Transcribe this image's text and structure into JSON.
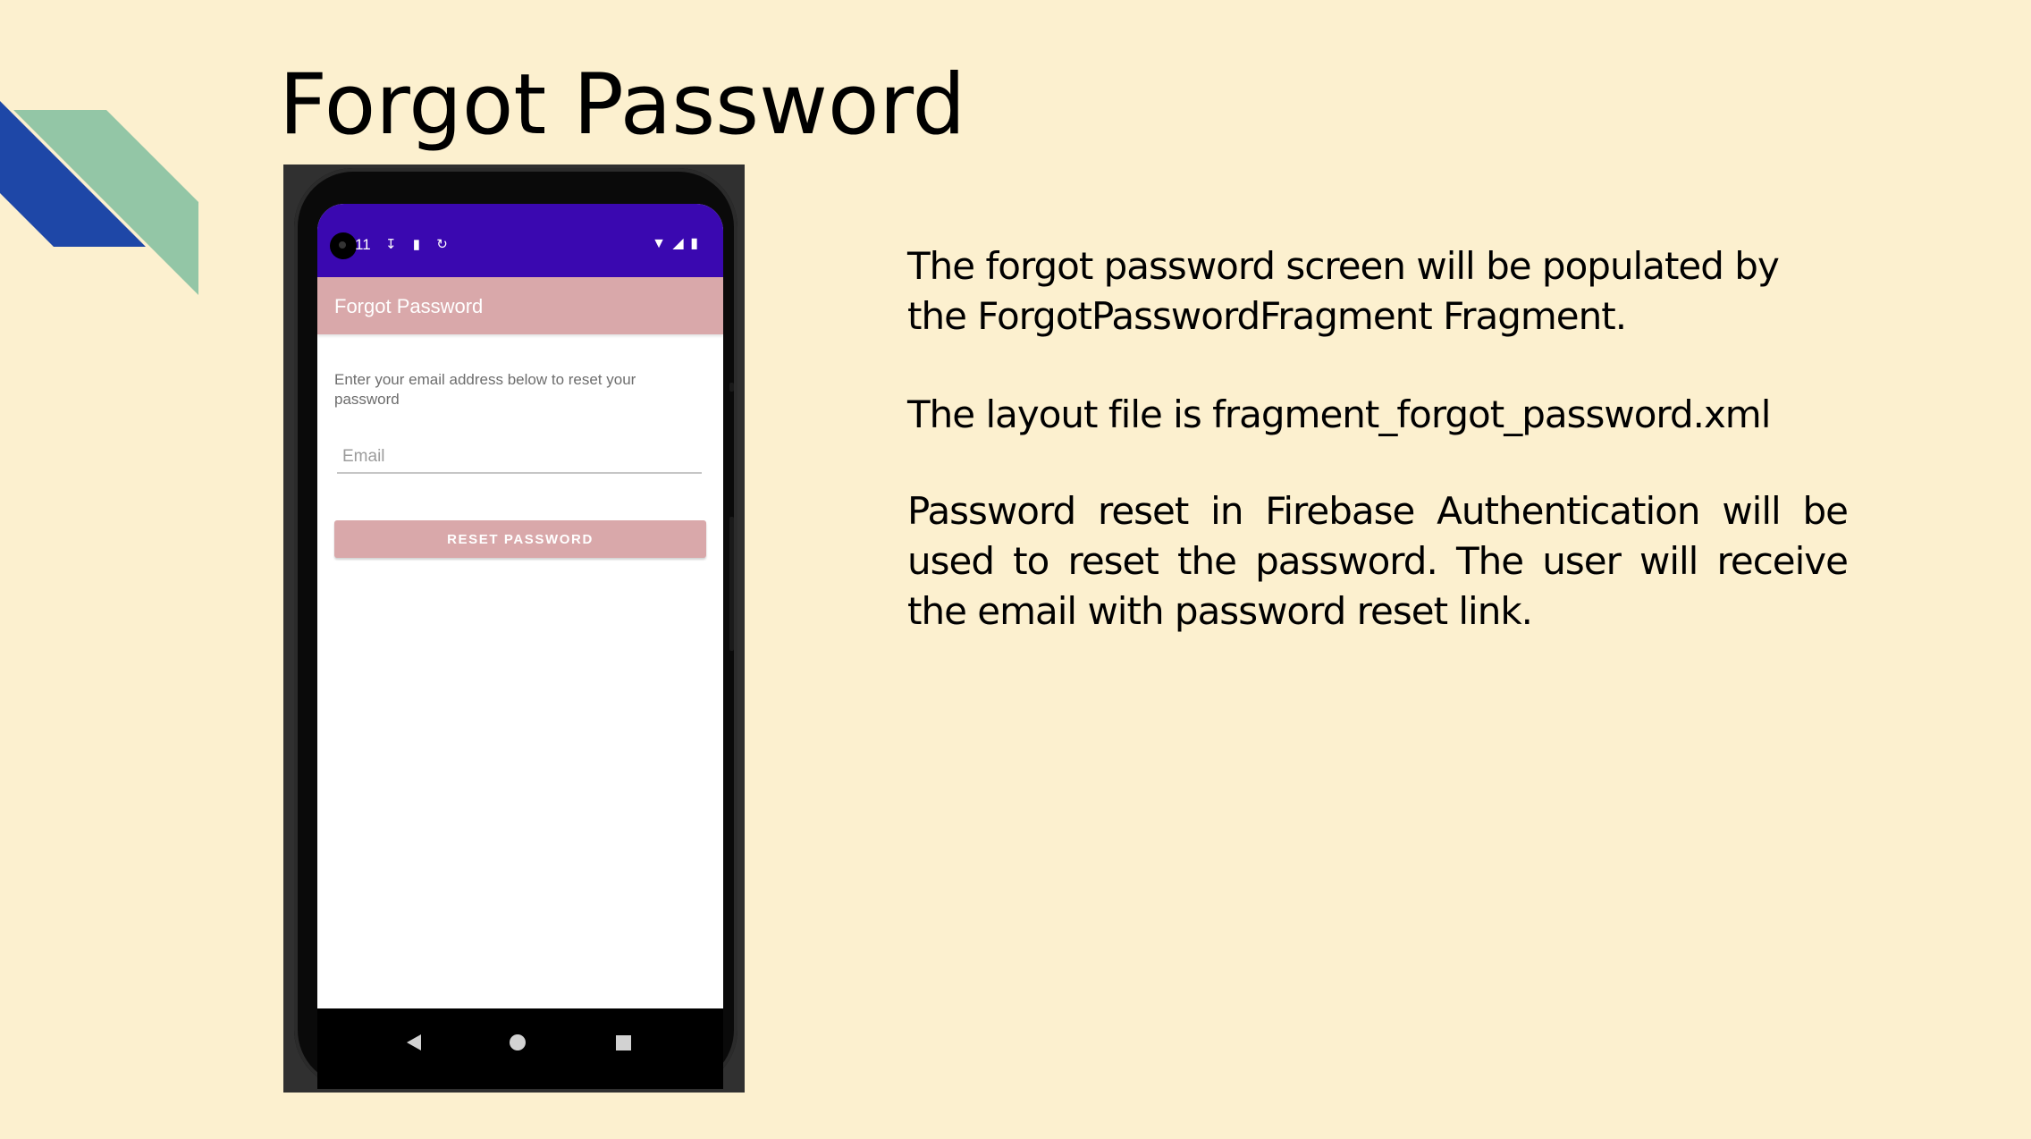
{
  "slide": {
    "title": "Forgot Password",
    "paragraphs": [
      "The forgot password screen will be populated by the ForgotPasswordFragment Fragment.",
      "The layout file is fragment_forgot_password.xml",
      "Password reset in Firebase Authentication will be used to reset the password. The user will receive the email with password reset link."
    ],
    "colors": {
      "background": "#fcf0cf",
      "accent_blue": "#1e47a7",
      "accent_green": "#93c6a6"
    }
  },
  "phone": {
    "status_bar": {
      "time": "11",
      "left_icons": [
        "download-icon",
        "sd-card-icon",
        "sync-icon"
      ],
      "right_icons": [
        "wifi-icon",
        "signal-icon",
        "battery-icon"
      ],
      "color": "#3a08b0"
    },
    "toolbar": {
      "title": "Forgot Password",
      "color": "#d9a8aa"
    },
    "description": "Enter your email address below to reset your password",
    "email": {
      "placeholder": "Email",
      "value": ""
    },
    "reset_button_label": "RESET PASSWORD",
    "nav_icons": [
      "back-icon",
      "home-icon",
      "recents-icon"
    ]
  }
}
